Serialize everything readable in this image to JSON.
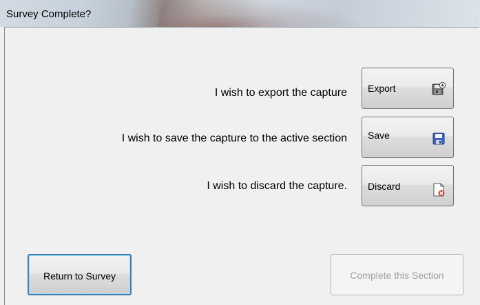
{
  "window": {
    "title": "Survey Complete?"
  },
  "actions": [
    {
      "prompt": "I wish to export the capture",
      "button": "Export",
      "icon": "export-disk-icon"
    },
    {
      "prompt": "I wish to save the capture to the active section",
      "button": "Save",
      "icon": "floppy-disk-icon"
    },
    {
      "prompt": "I wish to discard the capture.",
      "button": "Discard",
      "icon": "discard-page-icon"
    }
  ],
  "footer": {
    "return_label": "Return to Survey",
    "complete_label": "Complete this Section",
    "complete_enabled": false
  },
  "colors": {
    "focus_border": "#3c7fb1",
    "disabled_text": "#a0a0a0",
    "background": "#f0f0f0"
  }
}
